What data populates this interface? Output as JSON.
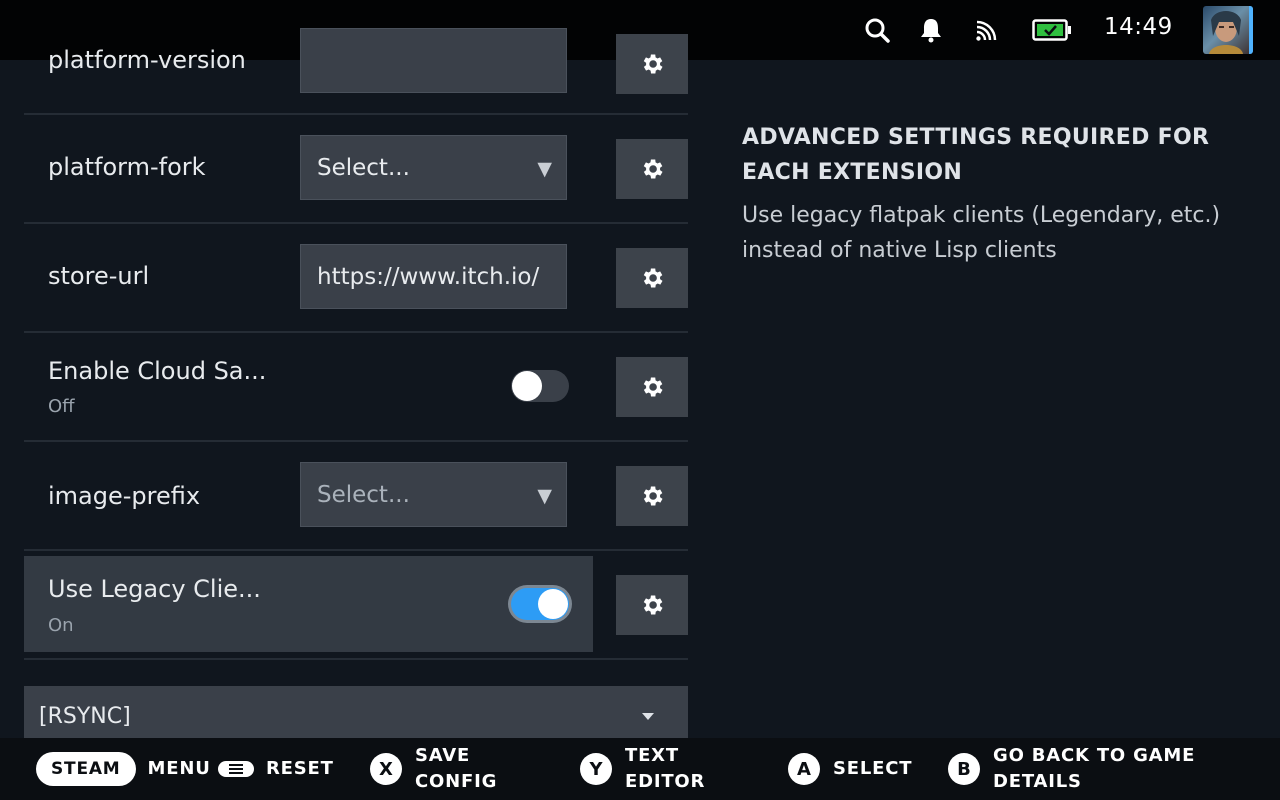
{
  "status_bar": {
    "time": "14:49",
    "icons": [
      "search-icon",
      "bell-icon",
      "cast-icon",
      "battery-charging-icon"
    ]
  },
  "settings": [
    {
      "label": "platform-version",
      "control": "text",
      "value": ""
    },
    {
      "label": "platform-fork",
      "control": "select",
      "value": "Select..."
    },
    {
      "label": "store-url",
      "control": "text",
      "value": "https://www.itch.io/"
    },
    {
      "label": "Enable Cloud Sa...",
      "control": "toggle",
      "state": "Off"
    },
    {
      "label": "image-prefix",
      "control": "select",
      "value": "Select..."
    },
    {
      "label": "Use Legacy Clie...",
      "control": "toggle",
      "state": "On"
    }
  ],
  "section_dropdown": {
    "label": "[RSYNC]"
  },
  "info_panel": {
    "heading": "ADVANCED SETTINGS REQUIRED FOR EACH EXTENSION",
    "description": "Use legacy flatpak clients (Legendary, etc.) instead of native Lisp clients"
  },
  "bottom_hints": {
    "steam": {
      "button": "STEAM",
      "label": "MENU"
    },
    "menu": {
      "label": "RESET"
    },
    "x": {
      "button": "X",
      "label_1": "SAVE",
      "label_2": "CONFIG"
    },
    "y": {
      "button": "Y",
      "label_1": "TEXT",
      "label_2": "EDITOR"
    },
    "a": {
      "button": "A",
      "label": "SELECT"
    },
    "b": {
      "button": "B",
      "label_1": "GO BACK TO GAME",
      "label_2": "DETAILS"
    }
  },
  "colors": {
    "accent": "#2d9cf5",
    "background": "#10161e",
    "control": "#3a4049"
  }
}
